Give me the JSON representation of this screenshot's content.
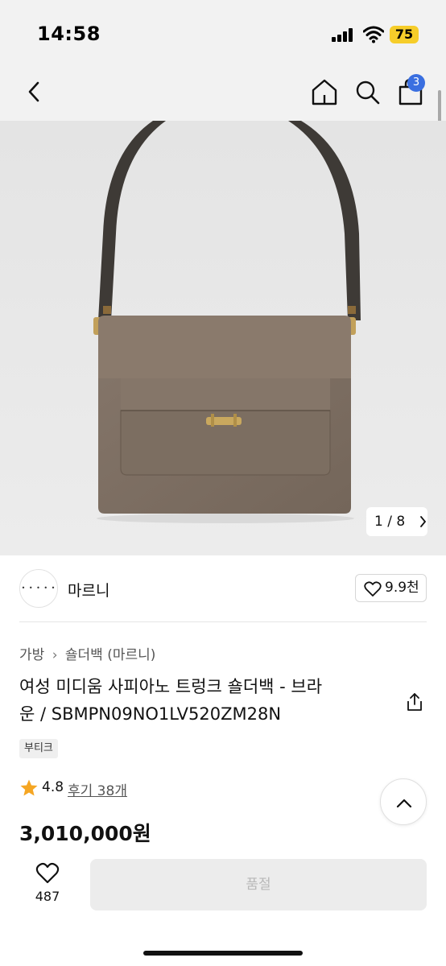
{
  "status_bar": {
    "time": "14:58",
    "battery": "75"
  },
  "nav": {
    "cart_count": "3",
    "icons": [
      "back-icon",
      "home-icon",
      "search-icon",
      "shopping-bag-icon"
    ]
  },
  "gallery": {
    "pager": "1 / 8",
    "image_alt": "brown shoulder bag product photo"
  },
  "brand": {
    "logo_text": "• • • • •",
    "name": "마르니",
    "likes": "9.9천"
  },
  "breadcrumb": {
    "category": "가방",
    "subcategory": "숄더백 (마르니)"
  },
  "product": {
    "title_line1": "여성 미디움 사피아노 트렁크 숄더백 - 브라",
    "title_line2": "운 / SBMPN09NO1LV520ZM28N",
    "tag": "부티크",
    "rating": "4.8",
    "reviews": "후기 38개",
    "price": "3,010,000원"
  },
  "bottom_bar": {
    "wish_count": "487",
    "buy_label": "품절"
  },
  "colors": {
    "accent_blue": "#3a6fe0",
    "star": "#f5a623",
    "bag_brown": "#7d6d5d"
  }
}
